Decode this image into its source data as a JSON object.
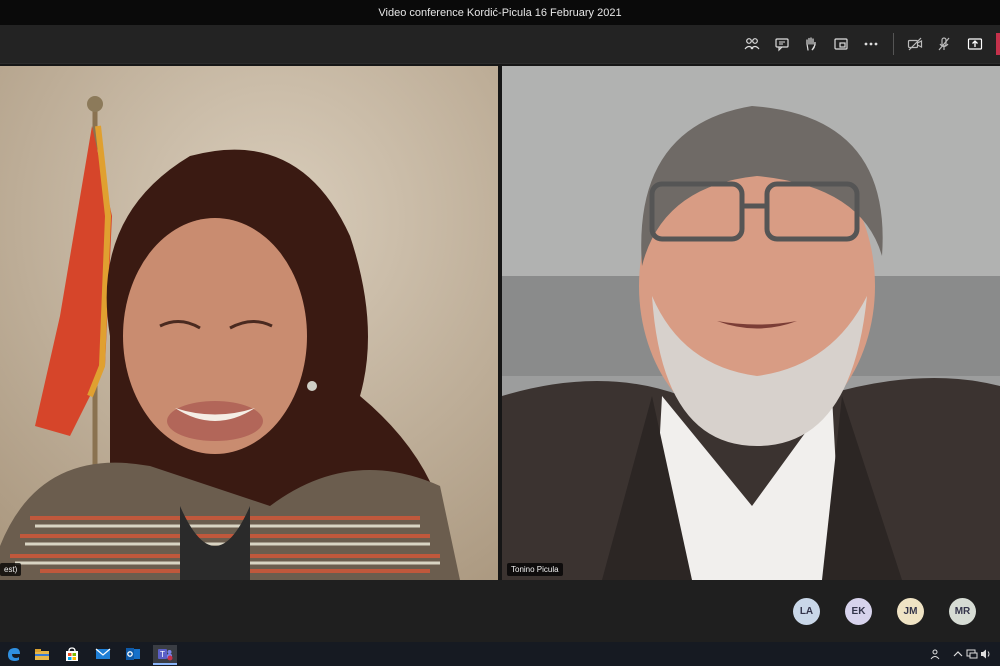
{
  "window": {
    "title": "Video conference Kordić-Picula 16 February 2021"
  },
  "toolbar": {
    "buttons": [
      {
        "name": "participants-icon",
        "label": "Participants"
      },
      {
        "name": "chat-icon",
        "label": "Chat"
      },
      {
        "name": "raise-hand-icon",
        "label": "Raise hand"
      },
      {
        "name": "breakout-icon",
        "label": "Rooms"
      },
      {
        "name": "more-actions-icon",
        "label": "More actions"
      },
      {
        "name": "camera-off-icon",
        "label": "Camera"
      },
      {
        "name": "mic-off-icon",
        "label": "Mic"
      },
      {
        "name": "share-screen-icon",
        "label": "Share"
      }
    ],
    "leave_color": "#c4314b"
  },
  "participants": {
    "left": {
      "name_tag": "est)"
    },
    "right": {
      "name_tag": "Tonino Picula"
    }
  },
  "roster": [
    {
      "initials": "LA",
      "color": "#c9d7e8"
    },
    {
      "initials": "EK",
      "color": "#d7d3ec"
    },
    {
      "initials": "JM",
      "color": "#efe3c4"
    },
    {
      "initials": "MR",
      "color": "#d6dcd4"
    }
  ],
  "taskbar": {
    "apps": [
      "edge-icon",
      "file-explorer-icon",
      "store-icon",
      "mail-icon",
      "outlook-icon",
      "teams-icon"
    ],
    "active_app": "teams-icon"
  }
}
